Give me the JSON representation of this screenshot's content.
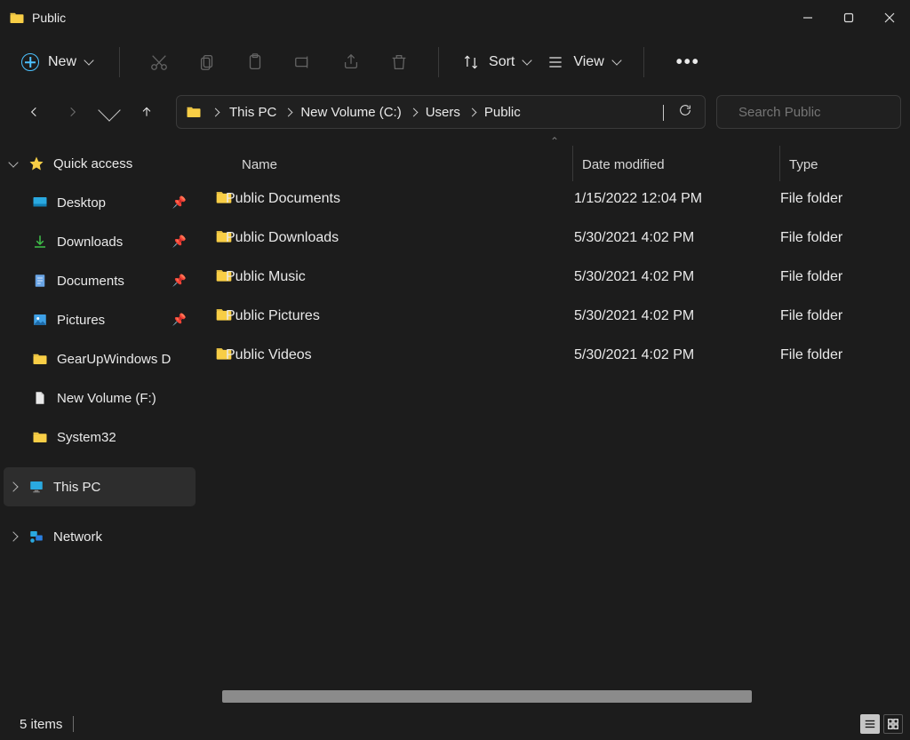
{
  "window": {
    "title": "Public"
  },
  "toolbar": {
    "new_label": "New",
    "sort_label": "Sort",
    "view_label": "View"
  },
  "breadcrumb": {
    "items": [
      "This PC",
      "New Volume (C:)",
      "Users",
      "Public"
    ]
  },
  "search": {
    "placeholder": "Search Public"
  },
  "sidebar": {
    "quick_access": "Quick access",
    "items": [
      {
        "label": "Desktop",
        "icon": "desktop",
        "pinned": true
      },
      {
        "label": "Downloads",
        "icon": "download",
        "pinned": true
      },
      {
        "label": "Documents",
        "icon": "document",
        "pinned": true
      },
      {
        "label": "Pictures",
        "icon": "pictures",
        "pinned": true
      },
      {
        "label": "GearUpWindows D",
        "icon": "folder",
        "pinned": false
      },
      {
        "label": "New Volume (F:)",
        "icon": "file",
        "pinned": false
      },
      {
        "label": "System32",
        "icon": "folder",
        "pinned": false
      }
    ],
    "this_pc": "This PC",
    "network": "Network"
  },
  "columns": {
    "name": "Name",
    "date": "Date modified",
    "type": "Type"
  },
  "rows": [
    {
      "name": "Public Documents",
      "date": "1/15/2022 12:04 PM",
      "type": "File folder"
    },
    {
      "name": "Public Downloads",
      "date": "5/30/2021 4:02 PM",
      "type": "File folder"
    },
    {
      "name": "Public Music",
      "date": "5/30/2021 4:02 PM",
      "type": "File folder"
    },
    {
      "name": "Public Pictures",
      "date": "5/30/2021 4:02 PM",
      "type": "File folder"
    },
    {
      "name": "Public Videos",
      "date": "5/30/2021 4:02 PM",
      "type": "File folder"
    }
  ],
  "status": {
    "count_text": "5 items"
  }
}
